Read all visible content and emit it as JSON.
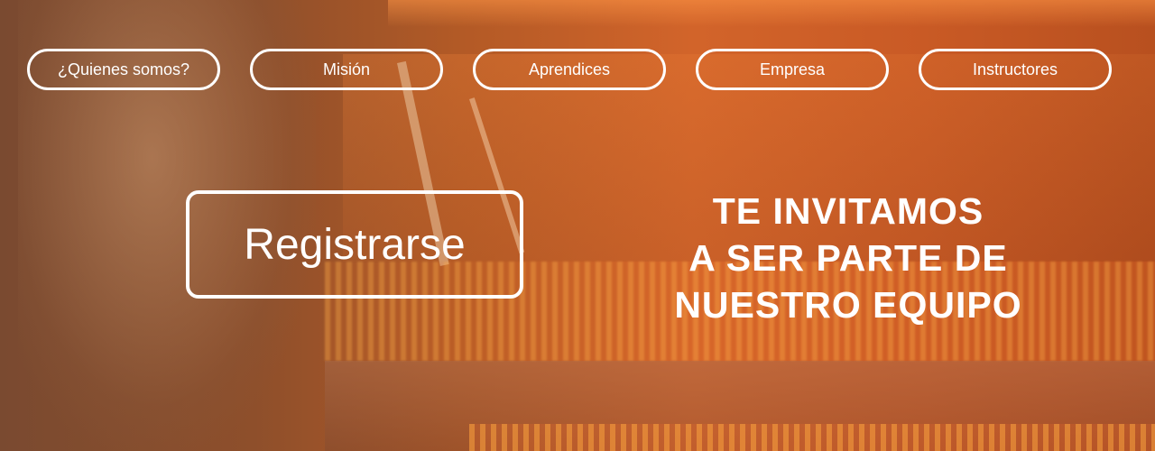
{
  "nav": {
    "items": [
      {
        "label": "¿Quienes somos?"
      },
      {
        "label": "Misión"
      },
      {
        "label": "Aprendices"
      },
      {
        "label": "Empresa"
      },
      {
        "label": "Instructores"
      }
    ]
  },
  "hero": {
    "register_label": "Registrarse",
    "headline_lines": [
      "TE INVITAMOS",
      "A SER PARTE DE",
      "NUESTRO EQUIPO"
    ]
  },
  "colors": {
    "overlay_orange": "#c95a25",
    "text": "#ffffff"
  }
}
